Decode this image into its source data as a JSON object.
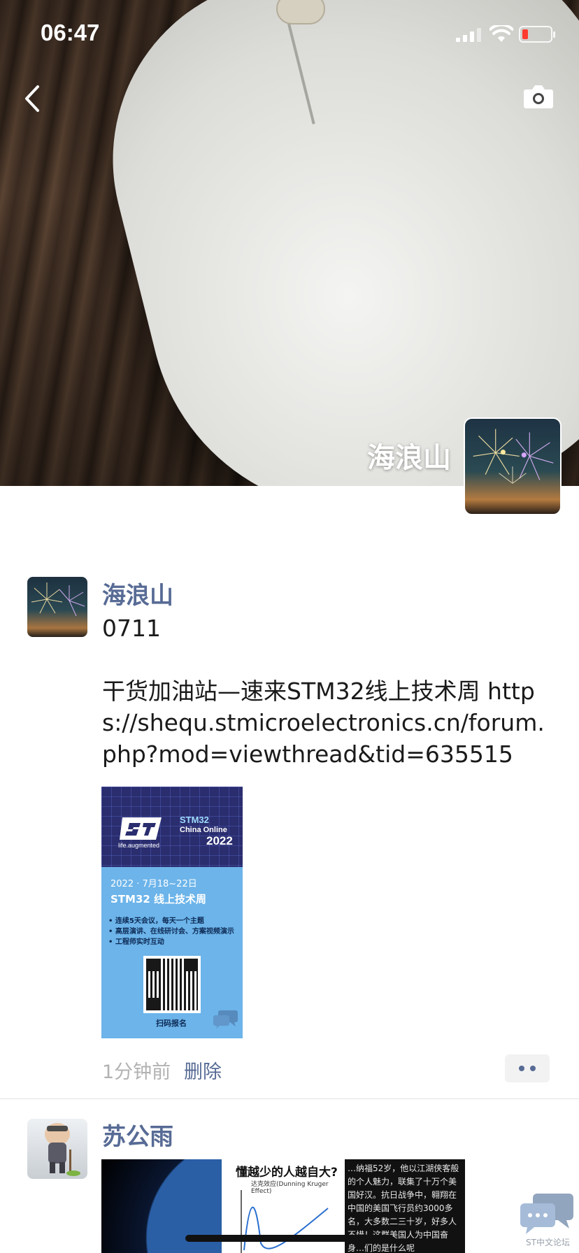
{
  "status_bar": {
    "time": "06:47",
    "battery_color": "#ff3b30"
  },
  "header": {
    "back_icon": "chevron-left-icon",
    "camera_icon": "camera-icon",
    "owner_name": "海浪山",
    "owner_avatar_icon": "fireworks-avatar"
  },
  "posts": [
    {
      "name": "海浪山",
      "text": "0711\n\n干货加油站—速来STM32线上技术周 https://shequ.stmicroelectronics.cn/forum.php?mod=viewthread&tid=635515",
      "image": {
        "logo_tagline": "life.augmented",
        "stm_title": "STM32",
        "stm_subtitle": "China Online",
        "stm_year": "2022",
        "date": "2022 · 7月18~22日",
        "event": "STM32 线上技术周",
        "bullets": [
          "• 连续5天会议，每天一个主题",
          "• 高层演讲、在线研讨会、方案视频演示",
          "• 工程师实时互动"
        ],
        "scan_label": "扫码报名"
      },
      "time": "1分钟前",
      "delete_label": "删除"
    },
    {
      "name": "苏公雨",
      "image2_title": "懂越少的人越自大?",
      "image2_subtitle": "达克效应(Dunning Kruger Effect)",
      "image3_text": "…纳福52岁，他以江湖侠客般的个人魅力，联集了十万个美国好汉。抗日战争中，翱翔在中国的美国飞行员约3000多名，大多数二三十岁，好多人不惜！这群美国人为中国奋身…们的是什么呢"
    }
  ],
  "floating": {
    "label": "ST中文论坛"
  },
  "colors": {
    "link_blue": "#576b95",
    "meta_gray": "#b2b2b2"
  }
}
